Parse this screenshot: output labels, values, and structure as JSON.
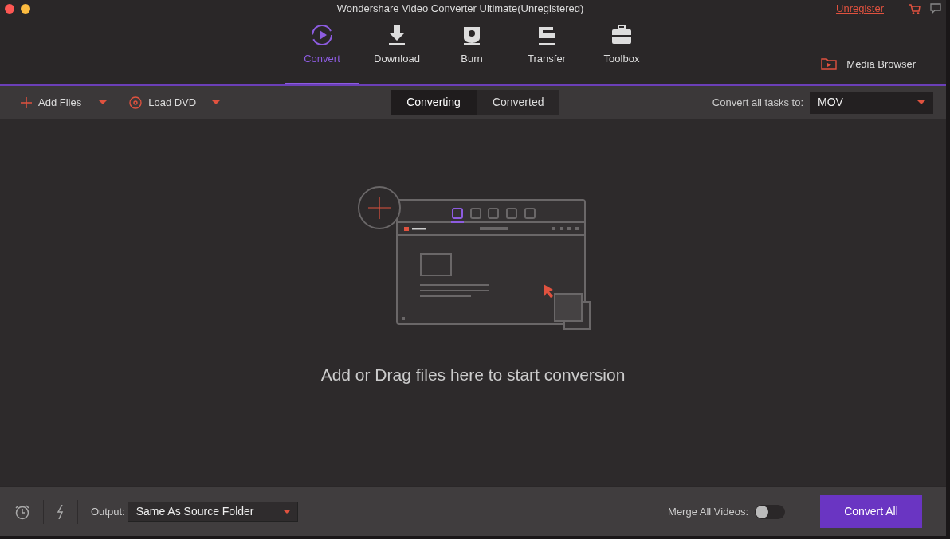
{
  "window": {
    "title": "Wondershare Video Converter Ultimate(Unregistered)",
    "unregister_link": "Unregister"
  },
  "nav_tabs": [
    {
      "label": "Convert",
      "kind": "convert",
      "selected": true
    },
    {
      "label": "Download",
      "kind": "download",
      "selected": false
    },
    {
      "label": "Burn",
      "kind": "burn",
      "selected": false
    },
    {
      "label": "Transfer",
      "kind": "transfer",
      "selected": false
    },
    {
      "label": "Toolbox",
      "kind": "toolbox",
      "selected": false
    }
  ],
  "media_browser": "Media Browser",
  "toolbar": {
    "add_files": "Add Files",
    "load_dvd": "Load DVD",
    "view_tabs": [
      {
        "label": "Converting",
        "selected": true
      },
      {
        "label": "Converted",
        "selected": false
      }
    ],
    "convert_all_label": "Convert all tasks to:",
    "format": "MOV"
  },
  "empty_message": "Add or Drag files here to start conversion",
  "bottom_bar": {
    "output_label": "Output:",
    "output_value": "Same As Source Folder",
    "merge_label": "Merge All Videos:",
    "merge_on": false,
    "convert_all": "Convert All"
  }
}
